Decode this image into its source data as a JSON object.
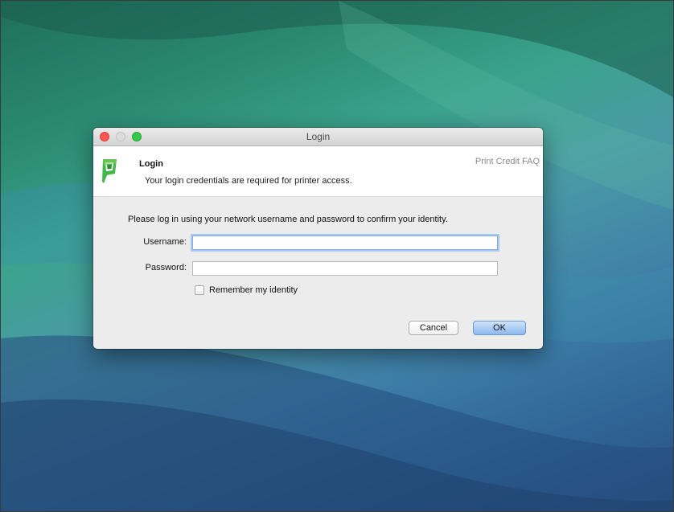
{
  "window": {
    "title": "Login"
  },
  "header": {
    "title": "Login",
    "subtitle": "Your login credentials are required for printer access.",
    "faq_link": "Print Credit FAQ",
    "logo_icon": "papercut-logo-icon",
    "logo_color": "#45b649"
  },
  "form": {
    "instruction": "Please log in using your network username and password to confirm your identity.",
    "username_label": "Username:",
    "username_value": "",
    "password_label": "Password:",
    "password_value": "",
    "remember_label": "Remember my identity",
    "remember_checked": false
  },
  "buttons": {
    "cancel_label": "Cancel",
    "ok_label": "OK"
  },
  "colors": {
    "close": "#fc5753",
    "minimize": "#dcdcdc",
    "zoom": "#34c84a",
    "default_button": "#8db9ee",
    "focus_ring": "#aac9ef"
  }
}
